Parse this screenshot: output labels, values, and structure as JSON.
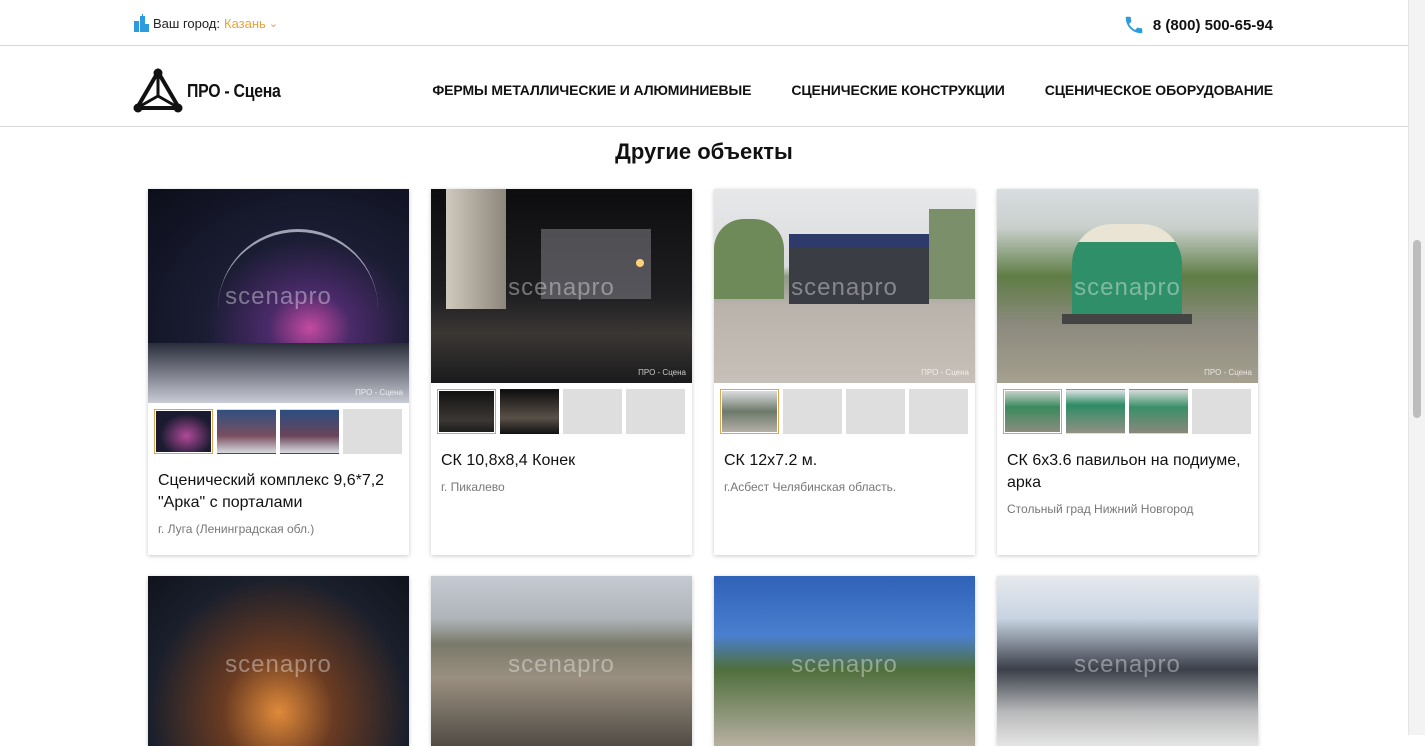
{
  "topbar": {
    "city_label": "Ваш город:",
    "city_value": "Казань",
    "phone": "8 (800) 500-65-94"
  },
  "brand": {
    "name": "ПРО - Сцена"
  },
  "nav": {
    "items": [
      {
        "label": "ФЕРМЫ МЕТАЛЛИЧЕСКИЕ И АЛЮМИНИЕВЫЕ"
      },
      {
        "label": "СЦЕНИЧЕСКИЕ КОНСТРУКЦИИ"
      },
      {
        "label": "СЦЕНИЧЕСКОЕ ОБОРУДОВАНИЕ"
      }
    ]
  },
  "section": {
    "title": "Другие объекты"
  },
  "colors": {
    "accent": "#e8a33c",
    "phone_icon": "#2d9be0"
  },
  "cards": [
    {
      "title": "Сценический комплекс 9,6*7,2 \"Арка\" с порталами",
      "location": "г. Луга (Ленинградская обл.)",
      "watermark": "scenapro",
      "watermark_small": "ПРО - Сцена"
    },
    {
      "title": "СК 10,8х8,4 Конек",
      "location": "г. Пикалево",
      "watermark": "scenapro",
      "watermark_small": "ПРО - Сцена"
    },
    {
      "title": "СК 12х7.2 м.",
      "location": "г.Асбест Челябинская область.",
      "watermark": "scenapro",
      "watermark_small": "ПРО - Сцена"
    },
    {
      "title": "СК 6х3.6 павильон на подиуме, арка",
      "location": "Стольный град Нижний Новгород",
      "watermark": "scenapro",
      "watermark_small": "ПРО - Сцена"
    },
    {
      "watermark": "scenapro"
    },
    {
      "watermark": "scenapro"
    },
    {
      "watermark": "scenapro"
    },
    {
      "watermark": "scenapro"
    }
  ]
}
